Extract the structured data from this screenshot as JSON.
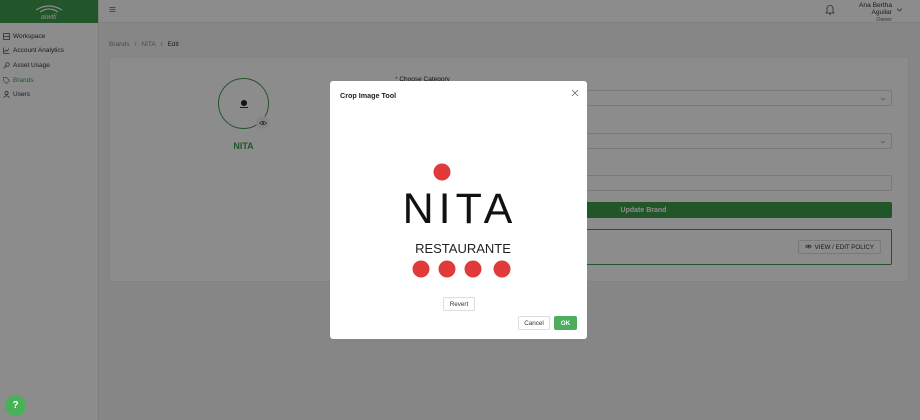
{
  "logo": {
    "text": "aiwifi"
  },
  "sidebar": {
    "items": [
      {
        "label": "Workspace",
        "icon": "workspace-icon"
      },
      {
        "label": "Account Analytics",
        "icon": "chart-icon"
      },
      {
        "label": "Asset Usage",
        "icon": "key-icon"
      },
      {
        "label": "Brands",
        "icon": "tag-icon",
        "active": true
      },
      {
        "label": "Users",
        "icon": "user-icon"
      }
    ]
  },
  "header": {
    "user_name": "Ana Bertha Aguilar",
    "user_role": "Owner"
  },
  "breadcrumb": [
    "Brands",
    "NITA",
    "Edit"
  ],
  "brand": {
    "name": "NITA",
    "accent": "#3f9c4d"
  },
  "form": {
    "category_label": "Choose Category",
    "update_label": "Update Brand",
    "policy_label": "VIEW / EDIT POLICY"
  },
  "modal": {
    "title": "Crop Image Tool",
    "logo_wordmark": "NITA",
    "logo_tagline": "RESTAURANTE",
    "logo_dot_color": "#e03a3a",
    "revert_label": "Revert",
    "cancel_label": "Cancel",
    "ok_label": "OK"
  },
  "help": {
    "label": "?"
  }
}
